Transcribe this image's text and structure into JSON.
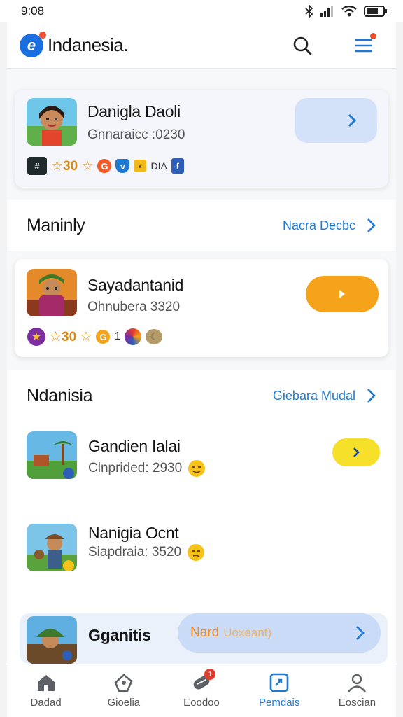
{
  "status": {
    "time": "9:08"
  },
  "app": {
    "title": "Indanesia."
  },
  "featured": {
    "name": "Danigla Daoli",
    "subtitle": "Gnnaraicc :0230",
    "badge_text": "☆30 ☆",
    "tag_text": "DIA"
  },
  "sections": [
    {
      "title": "Maninly",
      "link": "Nacra Decbc",
      "items": [
        {
          "name": "Sayadantanid",
          "subtitle": "Ohnubera 3320",
          "rating": "☆30 ☆",
          "extra": "1"
        }
      ]
    },
    {
      "title": "Ndanisia",
      "link": "Giebara Mudal",
      "items": [
        {
          "name": "Gandien Ialai",
          "subtitle": "Clnprided: 2930"
        },
        {
          "name": "Nanigia Ocnt",
          "subtitle": "Siapdraia: 3520"
        },
        {
          "name": "Gganitis",
          "button": "Nard",
          "button_suffix": "Uoxeant)"
        }
      ]
    }
  ],
  "nav": [
    {
      "label": "Dadad",
      "icon": "home-icon"
    },
    {
      "label": "Gioelia",
      "icon": "tag-icon"
    },
    {
      "label": "Eoodoo",
      "icon": "games-icon",
      "badge": "1"
    },
    {
      "label": "Pemdais",
      "icon": "apps-icon",
      "active": true
    },
    {
      "label": "Eoscian",
      "icon": "profile-icon"
    }
  ],
  "colors": {
    "accent": "#1f78d1",
    "orange": "#f5a31a",
    "yellow": "#f6e02a",
    "light_blue": "#d3e2f8"
  }
}
